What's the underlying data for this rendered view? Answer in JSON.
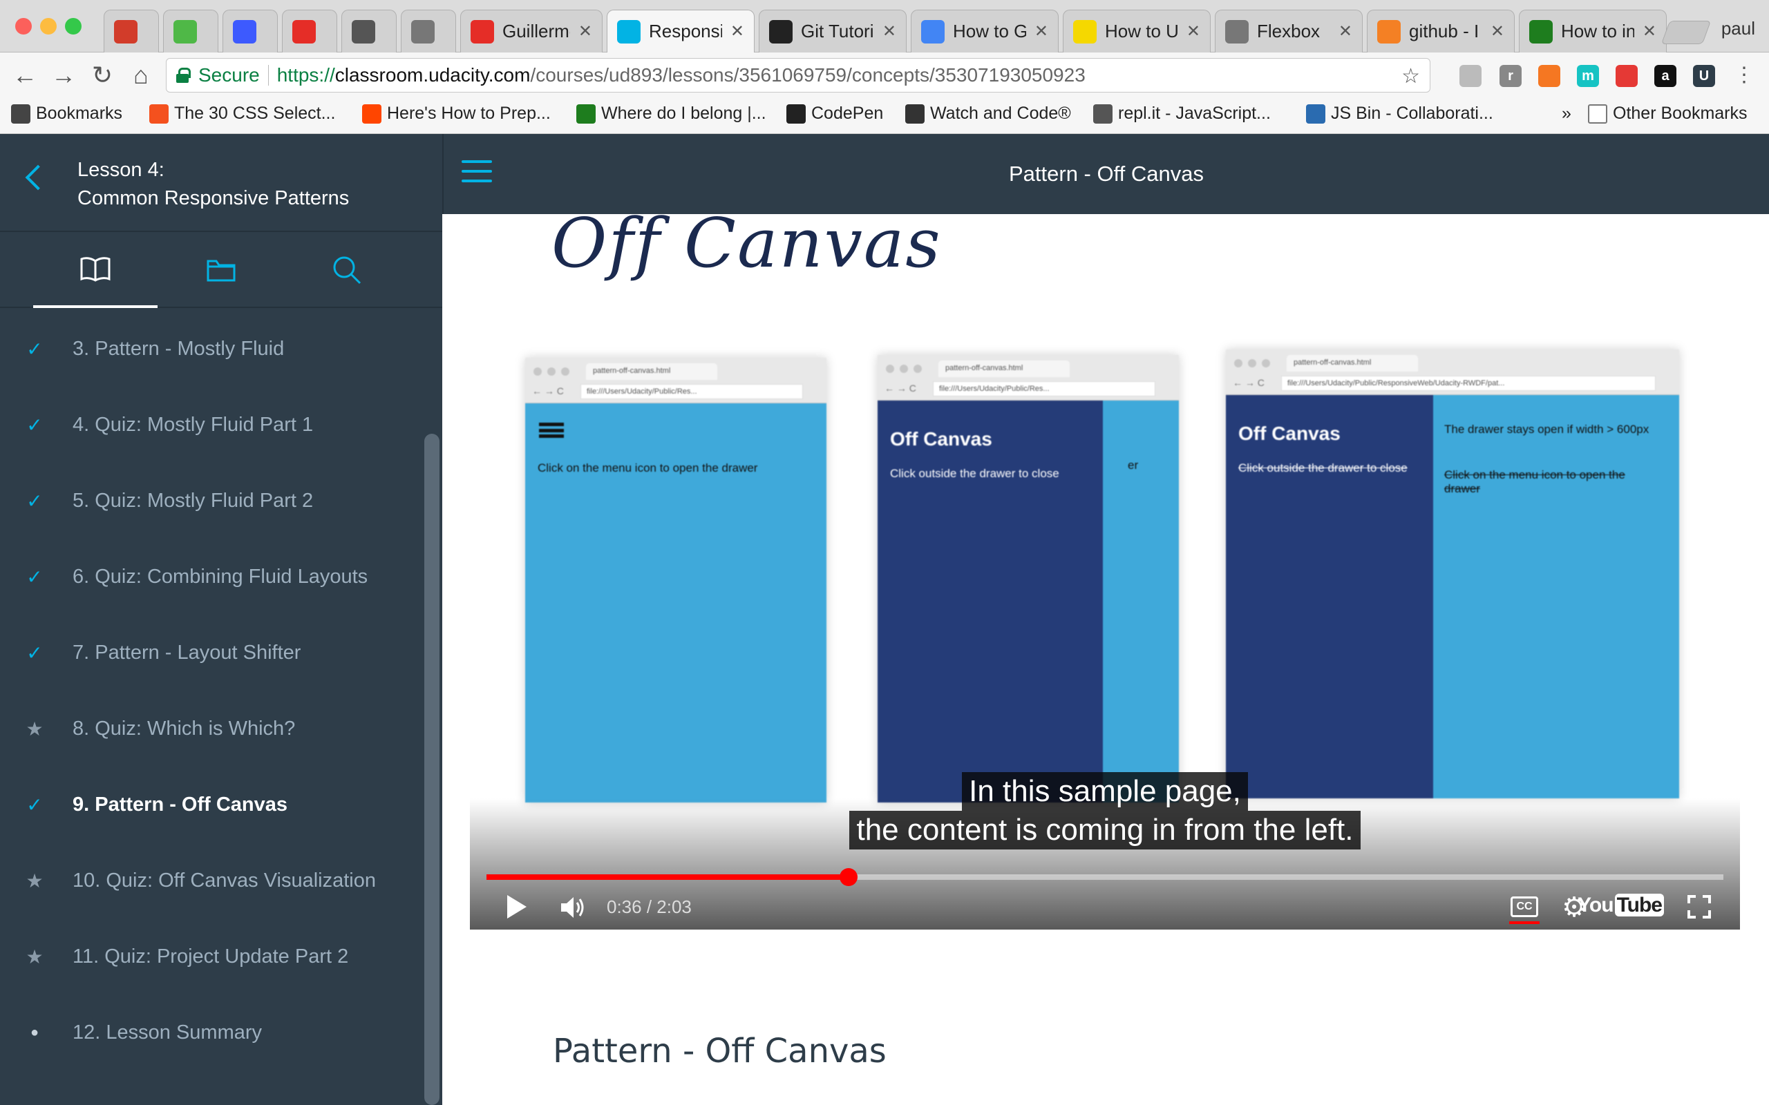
{
  "browser": {
    "window_controls": {
      "close_color": "#fc605b",
      "minimize_color": "#fdbc40",
      "maximize_color": "#34c84a"
    },
    "tabs": [
      {
        "title": "",
        "icon": "mascot-icon",
        "color": "#d23c2a"
      },
      {
        "title": "",
        "icon": "udacity-u-icon",
        "color": "#4fb847"
      },
      {
        "title": "",
        "icon": "c-letter-icon",
        "color": "#3d5afe"
      },
      {
        "title": "",
        "icon": "youtube-icon",
        "color": "#e52d27"
      },
      {
        "title": "",
        "icon": "camera-icon",
        "color": "#555555"
      },
      {
        "title": "",
        "icon": "document-icon",
        "color": "#777777"
      },
      {
        "title": "Guillermo",
        "icon": "youtube-icon",
        "color": "#e52d27"
      },
      {
        "title": "Responsiv",
        "icon": "udacity-icon",
        "color": "#02b3e4"
      },
      {
        "title": "Git Tutoria",
        "icon": "github-icon",
        "color": "#222222"
      },
      {
        "title": "How to Ge",
        "icon": "google-icon",
        "color": "#4285f4"
      },
      {
        "title": "How to Us",
        "icon": "d-letter-icon",
        "color": "#f5d800"
      },
      {
        "title": "Flexbox",
        "icon": "document-icon",
        "color": "#777777"
      },
      {
        "title": "github - I",
        "icon": "stackoverflow-icon",
        "color": "#f48024"
      },
      {
        "title": "How to int",
        "icon": "treehouse-icon",
        "color": "#1e7d1e"
      }
    ],
    "profile_name": "paul",
    "address": {
      "secure_label": "Secure",
      "url_scheme": "https://",
      "url_host": "classroom.udacity.com",
      "url_path": "/courses/ud893/lessons/3561069759/concepts/35307193050923"
    },
    "extensions": [
      {
        "icon": "cube-icon",
        "label": "",
        "color": "#bbbbbb"
      },
      {
        "icon": "r-letter-icon",
        "label": "r",
        "color": "#888888"
      },
      {
        "icon": "hubspot-icon",
        "label": "",
        "color": "#f57722"
      },
      {
        "icon": "m-circle-icon",
        "label": "m",
        "color": "#16c3c3"
      },
      {
        "icon": "tomato-icon",
        "label": "",
        "color": "#e53935"
      },
      {
        "icon": "amazon-icon",
        "label": "a",
        "color": "#111111"
      },
      {
        "icon": "udacity-ext-icon",
        "label": "U",
        "color": "#2e3d49"
      }
    ],
    "bookmarks": [
      {
        "label": "Bookmarks",
        "icon": "list-icon",
        "color": "#444444"
      },
      {
        "label": "The 30 CSS Select...",
        "icon": "plus-square-icon",
        "color": "#f4511e"
      },
      {
        "label": "Here's How to Prep...",
        "icon": "reddit-icon",
        "color": "#ff4500"
      },
      {
        "label": "Where do I belong |...",
        "icon": "treehouse-icon",
        "color": "#1e7d1e"
      },
      {
        "label": "CodePen",
        "icon": "codepen-icon",
        "color": "#222222"
      },
      {
        "label": "Watch and Code®",
        "icon": "w-letter-icon",
        "color": "#333333"
      },
      {
        "label": "repl.it - JavaScript...",
        "icon": "repl-icon",
        "color": "#555555"
      },
      {
        "label": "JS Bin - Collaborati...",
        "icon": "jsbin-icon",
        "color": "#2a6bb0"
      }
    ],
    "bookmarks_overflow": "»",
    "other_bookmarks": "Other Bookmarks"
  },
  "sidebar": {
    "lesson_number": "Lesson 4:",
    "lesson_title": "Common Responsive Patterns",
    "accent_color": "#02b3e4",
    "tabs": [
      {
        "icon": "book-icon",
        "active": true
      },
      {
        "icon": "folder-icon",
        "active": false
      },
      {
        "icon": "search-icon",
        "active": false
      }
    ],
    "items": [
      {
        "label": "3. Pattern - Mostly Fluid",
        "status": "check",
        "current": false
      },
      {
        "label": "4. Quiz: Mostly Fluid Part 1",
        "status": "check",
        "current": false
      },
      {
        "label": "5. Quiz: Mostly Fluid Part 2",
        "status": "check",
        "current": false
      },
      {
        "label": "6. Quiz: Combining Fluid Layouts",
        "status": "check",
        "current": false
      },
      {
        "label": "7. Pattern - Layout Shifter",
        "status": "check",
        "current": false
      },
      {
        "label": "8. Quiz: Which is Which?",
        "status": "star",
        "current": false
      },
      {
        "label": "9. Pattern - Off Canvas",
        "status": "check",
        "current": true
      },
      {
        "label": "10. Quiz: Off Canvas Visualization",
        "status": "star",
        "current": false
      },
      {
        "label": "11. Quiz: Project Update Part 2",
        "status": "star",
        "current": false
      },
      {
        "label": "12. Lesson Summary",
        "status": "dot",
        "current": false
      }
    ]
  },
  "topbar": {
    "title": "Pattern - Off Canvas"
  },
  "video": {
    "slide_title": "Off Canvas",
    "mockups": [
      {
        "tab_label": "pattern-off-canvas.html",
        "address": "file:///Users/Udacity/Public/Res...",
        "drawer_open": false,
        "text": "Click on the menu icon to open the drawer"
      },
      {
        "tab_label": "pattern-off-canvas.html",
        "address": "file:///Users/Udacity/Public/Res...",
        "drawer_open": true,
        "drawer_title": "Off Canvas",
        "drawer_text": "Click outside the drawer to close",
        "peek_text": "er"
      },
      {
        "tab_label": "pattern-off-canvas.html",
        "address": "file:///Users/Udacity/Public/ResponsiveWeb/Udacity-RWDF/pat...",
        "drawer_open": true,
        "drawer_title": "Off Canvas",
        "drawer_text": "Click outside the drawer to close",
        "main_text_1": "The drawer stays open if width > 600px",
        "main_text_2": "Click on the menu icon to open the drawer"
      }
    ],
    "captions": [
      "In this sample page,",
      "the content is coming in from the left."
    ],
    "current_time": "0:36",
    "duration": "2:03",
    "time_display": "0:36 / 2:03",
    "progress_fraction": 0.2927,
    "progress_color": "#ff0000",
    "youtube_label": "You",
    "youtube_label_tube": "Tube",
    "cc_label": "CC"
  },
  "main": {
    "heading": "Pattern - Off Canvas"
  }
}
